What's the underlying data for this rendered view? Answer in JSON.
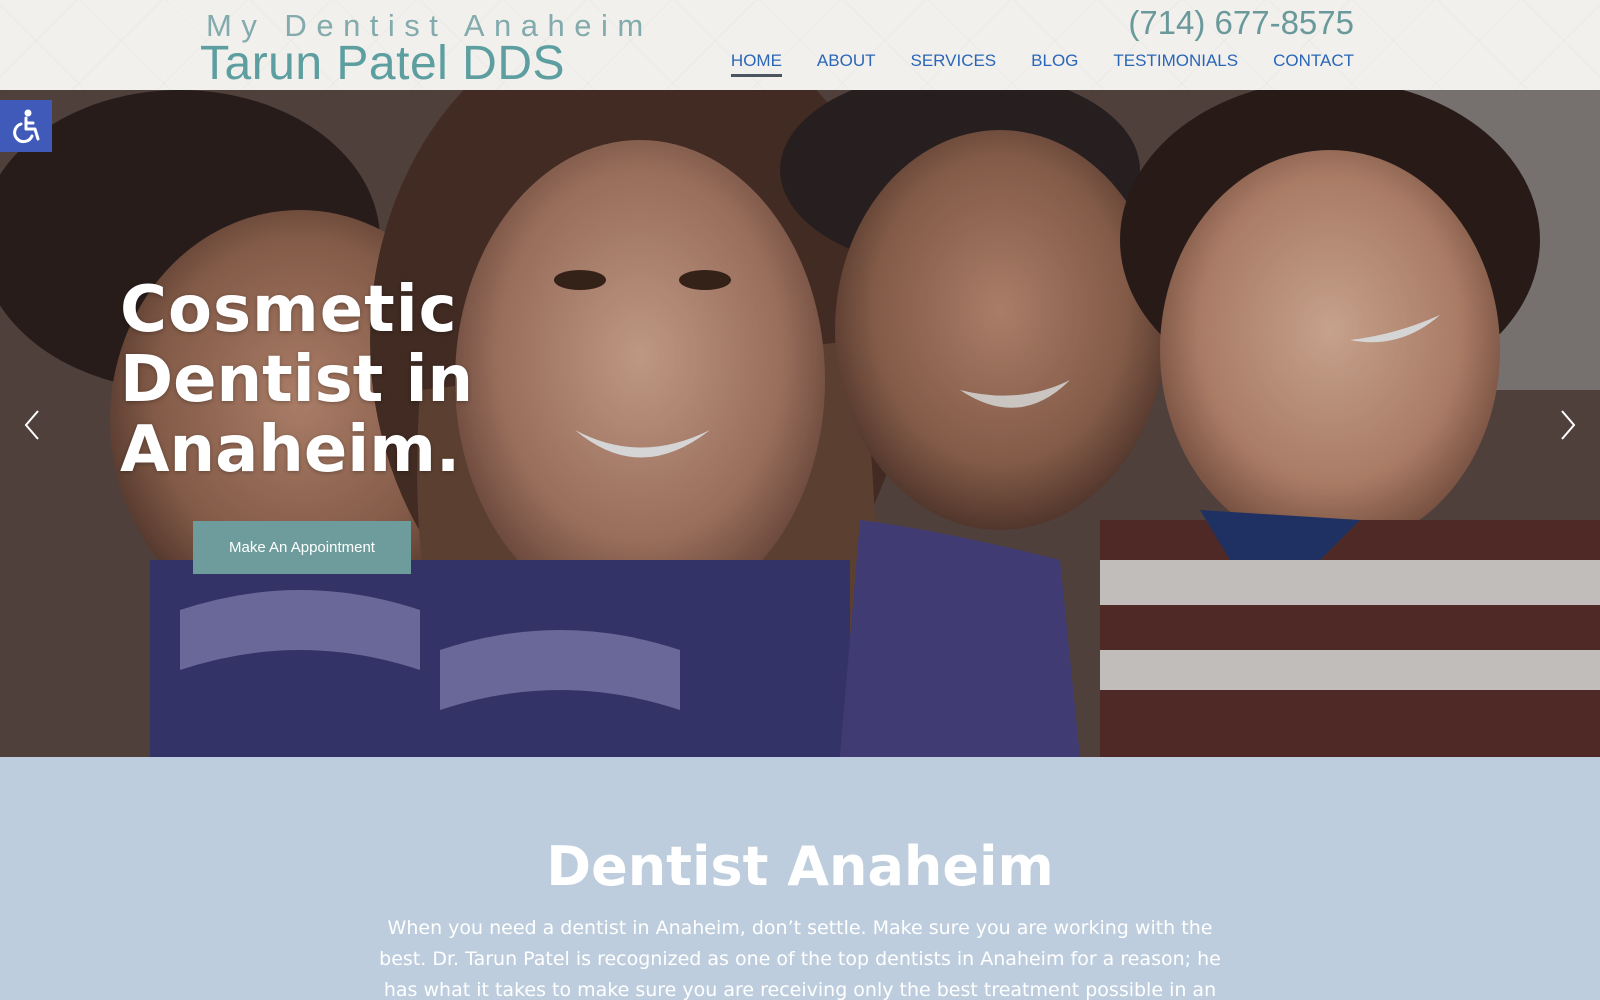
{
  "header": {
    "logo_top": "My Dentist Anaheim",
    "logo_bottom": "Tarun Patel DDS",
    "phone": "(714) 677-8575",
    "nav": [
      {
        "label": "HOME",
        "active": true
      },
      {
        "label": "ABOUT"
      },
      {
        "label": "SERVICES"
      },
      {
        "label": "BLOG"
      },
      {
        "label": "TESTIMONIALS"
      },
      {
        "label": "CONTACT"
      }
    ]
  },
  "accessibility": {
    "icon": "accessibility-icon",
    "color": "#3f5ab8"
  },
  "hero": {
    "title_line1": "Cosmetic",
    "title_bold": "Dentist",
    "title_rest": " in",
    "title_line3": "Anaheim.",
    "cta_label": "Make An Appointment",
    "prev_icon": "chevron-left-icon",
    "next_icon": "chevron-right-icon"
  },
  "content": {
    "heading": "Dentist Anaheim",
    "paragraph": "When you need a dentist in Anaheim, don’t settle. Make sure you are working with the best. Dr. Tarun Patel is recognized as one of the top dentists in Anaheim for a reason; he has what it takes to make sure you are receiving only the best treatment possible in an environment"
  },
  "colors": {
    "nav_link": "#2a66b8",
    "brand_teal": "#5d9ea0",
    "cta_bg": "#6e9c9c",
    "content_bg": "#bdcddd"
  }
}
